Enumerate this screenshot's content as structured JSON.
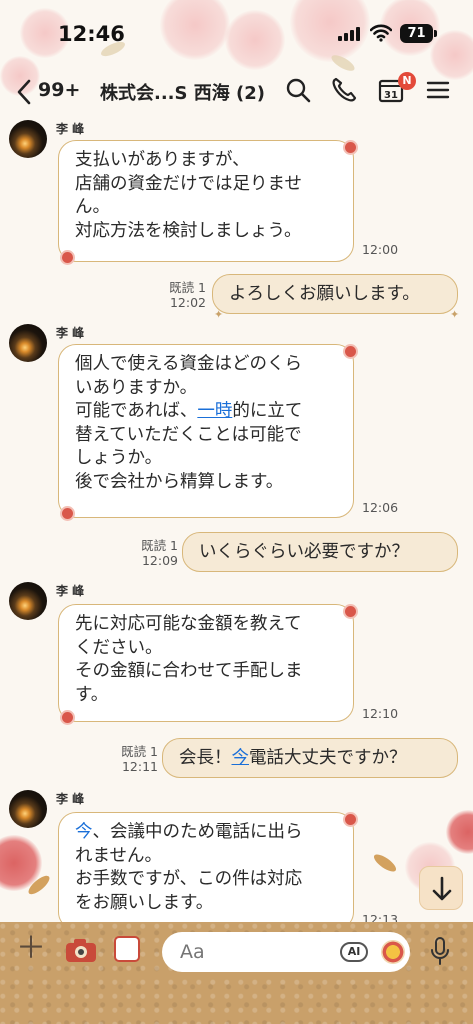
{
  "status_bar": {
    "time": "12:46",
    "battery": "71"
  },
  "header": {
    "back_icon": "chevron-left-icon",
    "unread_count": "99+",
    "room_title": "株式会...S 西海 (2)",
    "calendar_day": "31",
    "calendar_badge": "N"
  },
  "messages": [
    {
      "direction": "in",
      "sender": "李 峰",
      "lines": [
        "支払いがありますが、",
        "店舗の資金だけでは足りませ",
        "ん。",
        "対応方法を検討しましょう。"
      ],
      "time": "12:00"
    },
    {
      "direction": "out",
      "read_status": "既読 1",
      "time": "12:02",
      "text": "よろしくお願いします。"
    },
    {
      "direction": "in",
      "sender": "李 峰",
      "lines": [
        "個人で使える資金はどのくら",
        "いありますか。",
        "可能であれば、",
        "一時",
        "的に立て",
        "替えていただくことは可能で",
        "しょうか。",
        "後で会社から精算します。"
      ],
      "time": "12:06"
    },
    {
      "direction": "out",
      "read_status": "既読 1",
      "time": "12:09",
      "text": "いくらぐらい必要ですか？"
    },
    {
      "direction": "in",
      "sender": "李 峰",
      "lines": [
        "先に対応可能な金額を教えて",
        "ください。",
        "その金額に合わせて手配しま",
        "す。"
      ],
      "time": "12:10"
    },
    {
      "direction": "out",
      "read_status": "既読 1",
      "time": "12:11",
      "text_before": "会長！",
      "text_link": "今",
      "text_after": "電話大丈夫ですか？"
    },
    {
      "direction": "in",
      "sender": "李 峰",
      "link_word": "今",
      "lines": [
        "、会議中のため電話に出ら",
        "れません。",
        "お手数ですが、この件は対応",
        "をお願いします。"
      ],
      "time": "12:13"
    }
  ],
  "input_bar": {
    "placeholder": "Aa",
    "ai_label": "AI"
  },
  "colors": {
    "bubble_border": "#d8b77a",
    "outgoing_bubble": "#f6ead6",
    "link": "#1a6fd8",
    "badge": "#e34a3a",
    "bottom_bar": "#c9a06a"
  }
}
